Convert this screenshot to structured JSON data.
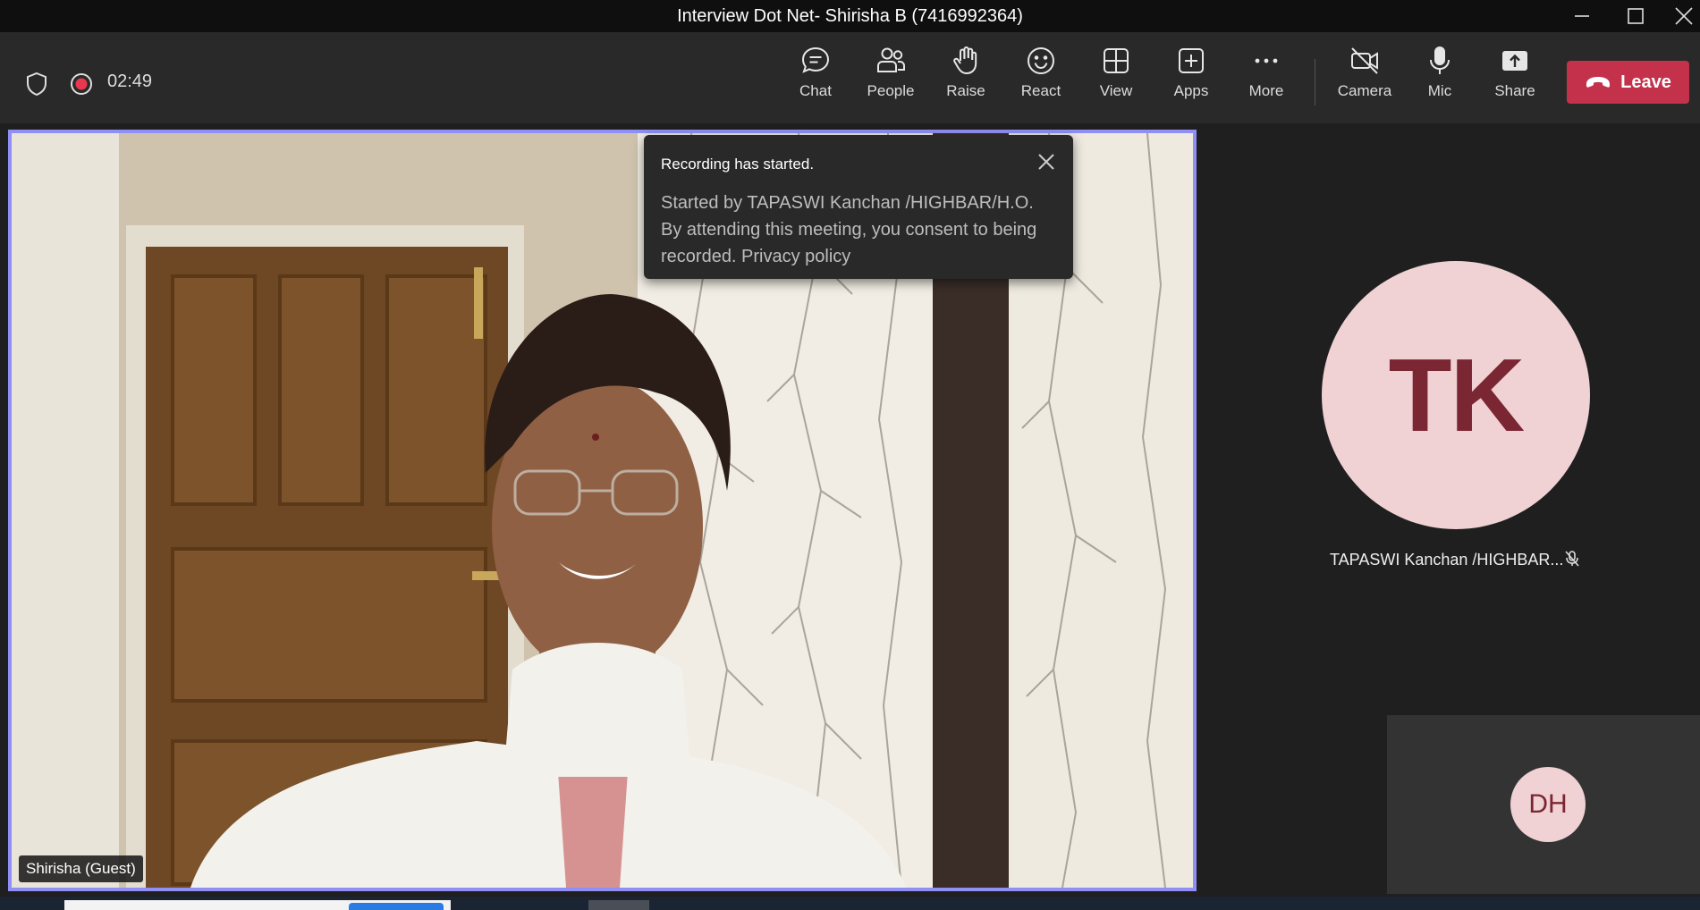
{
  "window": {
    "title": "Interview Dot Net- Shirisha B (7416992364)"
  },
  "toolbar": {
    "timer": "02:49",
    "items": [
      {
        "label": "Chat",
        "icon": "chat-icon"
      },
      {
        "label": "People",
        "icon": "people-icon"
      },
      {
        "label": "Raise",
        "icon": "raise-hand-icon"
      },
      {
        "label": "React",
        "icon": "react-icon"
      },
      {
        "label": "View",
        "icon": "view-icon"
      },
      {
        "label": "Apps",
        "icon": "apps-icon"
      },
      {
        "label": "More",
        "icon": "more-icon"
      },
      {
        "label": "Camera",
        "icon": "camera-off-icon"
      },
      {
        "label": "Mic",
        "icon": "mic-icon"
      },
      {
        "label": "Share",
        "icon": "share-icon"
      }
    ],
    "leave_label": "Leave"
  },
  "notification": {
    "title": "Recording has started.",
    "body": "Started by TAPASWI Kanchan /HIGHBAR/H.O. By attending this meeting, you consent to being recorded. Privacy policy"
  },
  "main_video": {
    "name": "Shirisha (Guest)"
  },
  "participants": [
    {
      "initials": "TK",
      "name": "TAPASWI Kanchan /HIGHBAR...",
      "muted": true
    },
    {
      "initials": "DH"
    }
  ],
  "colors": {
    "accent": "#8f8ff5",
    "leave": "#c4314b",
    "recording": "#e8384f",
    "avatar_bg": "#f0d2d5",
    "avatar_text": "#7a2633"
  }
}
